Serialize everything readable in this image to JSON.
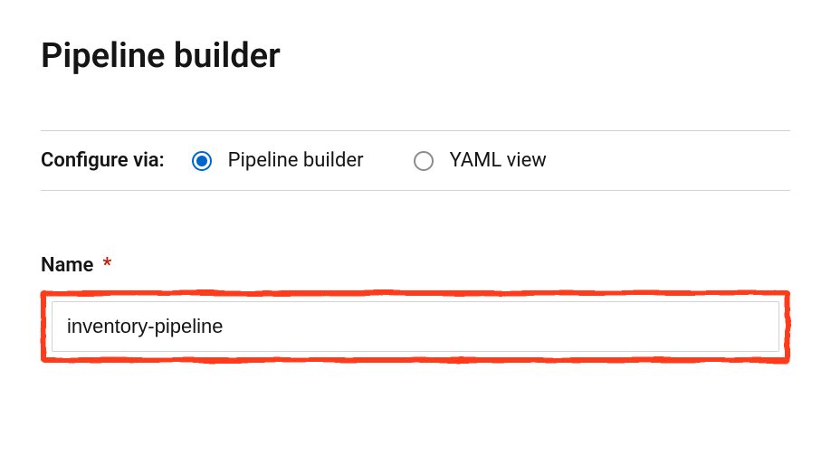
{
  "header": {
    "title": "Pipeline builder"
  },
  "config": {
    "label": "Configure via:",
    "options": [
      {
        "label": "Pipeline builder",
        "selected": true
      },
      {
        "label": "YAML view",
        "selected": false
      }
    ]
  },
  "form": {
    "name": {
      "label": "Name",
      "required": "*",
      "value": "inventory-pipeline"
    }
  }
}
